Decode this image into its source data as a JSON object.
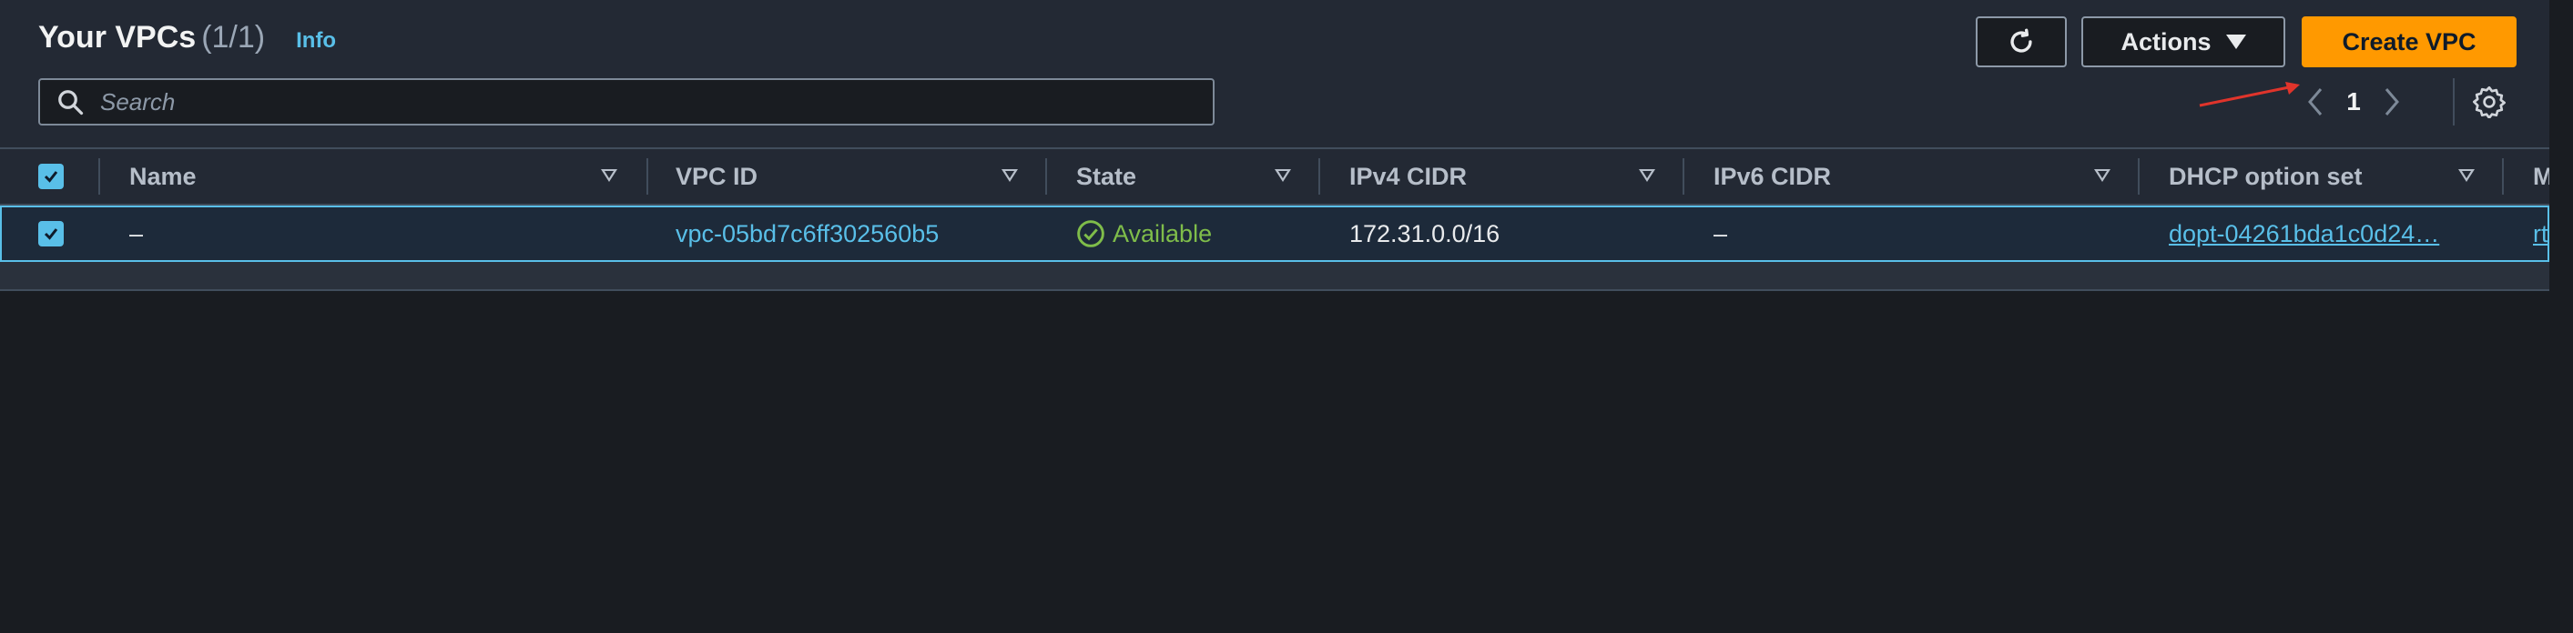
{
  "header": {
    "title": "Your VPCs",
    "count": "(1/1)",
    "info_label": "Info"
  },
  "search": {
    "placeholder": "Search",
    "value": ""
  },
  "toolbar": {
    "refresh_icon": "refresh-icon",
    "actions_label": "Actions",
    "create_label": "Create VPC"
  },
  "pagination": {
    "current_page": "1",
    "prev_icon": "chevron-left-icon",
    "next_icon": "chevron-right-icon",
    "settings_icon": "gear-icon"
  },
  "table": {
    "columns": [
      "Name",
      "VPC ID",
      "State",
      "IPv4 CIDR",
      "IPv6 CIDR",
      "DHCP option set",
      "M"
    ],
    "rows": [
      {
        "selected": true,
        "name": "–",
        "vpc_id": "vpc-05bd7c6ff302560b5",
        "state": "Available",
        "ipv4_cidr": "172.31.0.0/16",
        "ipv6_cidr": "–",
        "dhcp_option_set": "dopt-04261bda1c0d24…",
        "main_route_table": "rt"
      }
    ]
  },
  "colors": {
    "accent": "#59bfe8",
    "primary_button": "#ff9900",
    "status_ok": "#7fbd4a",
    "annotation": "#e0342b"
  }
}
